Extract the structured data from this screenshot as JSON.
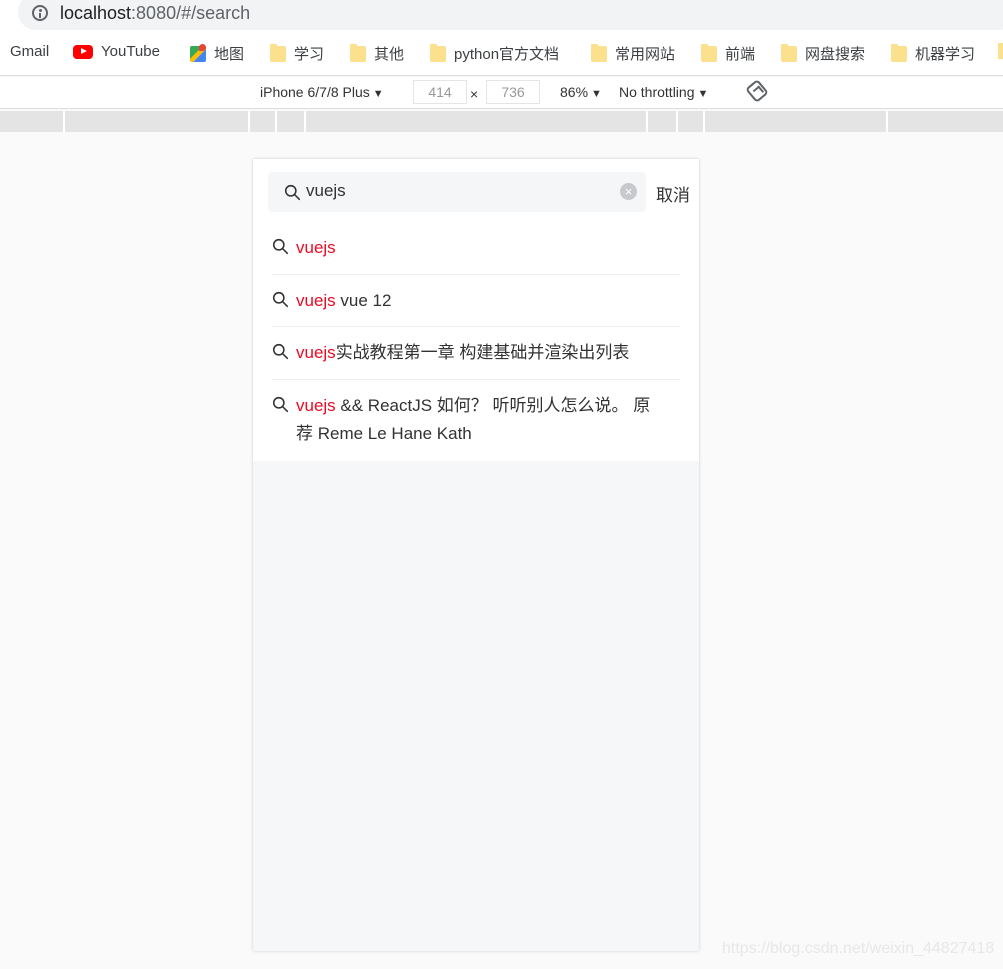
{
  "browser": {
    "url_host": "localhost",
    "url_rest": ":8080/#/search"
  },
  "bookmarks": [
    {
      "label": "Gmail",
      "icon": "gmail-icon"
    },
    {
      "label": "YouTube",
      "icon": "youtube-icon"
    },
    {
      "label": "地图",
      "icon": "maps-icon"
    },
    {
      "label": "学习",
      "icon": "folder-icon"
    },
    {
      "label": "其他",
      "icon": "folder-icon"
    },
    {
      "label": "python官方文档",
      "icon": "folder-icon"
    },
    {
      "label": "常用网站",
      "icon": "folder-icon"
    },
    {
      "label": "前端",
      "icon": "folder-icon"
    },
    {
      "label": "网盘搜索",
      "icon": "folder-icon"
    },
    {
      "label": "机器学习",
      "icon": "folder-icon"
    }
  ],
  "devtools": {
    "device": "iPhone 6/7/8 Plus",
    "width": "414",
    "height": "736",
    "times": "×",
    "zoom": "86%",
    "throttling": "No throttling",
    "caret": "▼"
  },
  "search": {
    "value": "vuejs",
    "cancel_label": "取消",
    "clear_glyph": "×"
  },
  "suggestions": [
    {
      "highlight": "vuejs",
      "rest": ""
    },
    {
      "highlight": "vuejs",
      "rest": " vue 12"
    },
    {
      "highlight": "vuejs",
      "rest": "实战教程第一章 构建基础并渲染出列表"
    },
    {
      "highlight": "vuejs",
      "rest": " && ReactJS 如何？ 听听别人怎么说。 原 荐 Reme Le Hane Kath"
    }
  ],
  "watermark": "https://blog.csdn.net/weixin_44827418",
  "colors": {
    "highlight": "#ee0a24",
    "text": "#323233",
    "page_bg": "#f6f7f9"
  }
}
